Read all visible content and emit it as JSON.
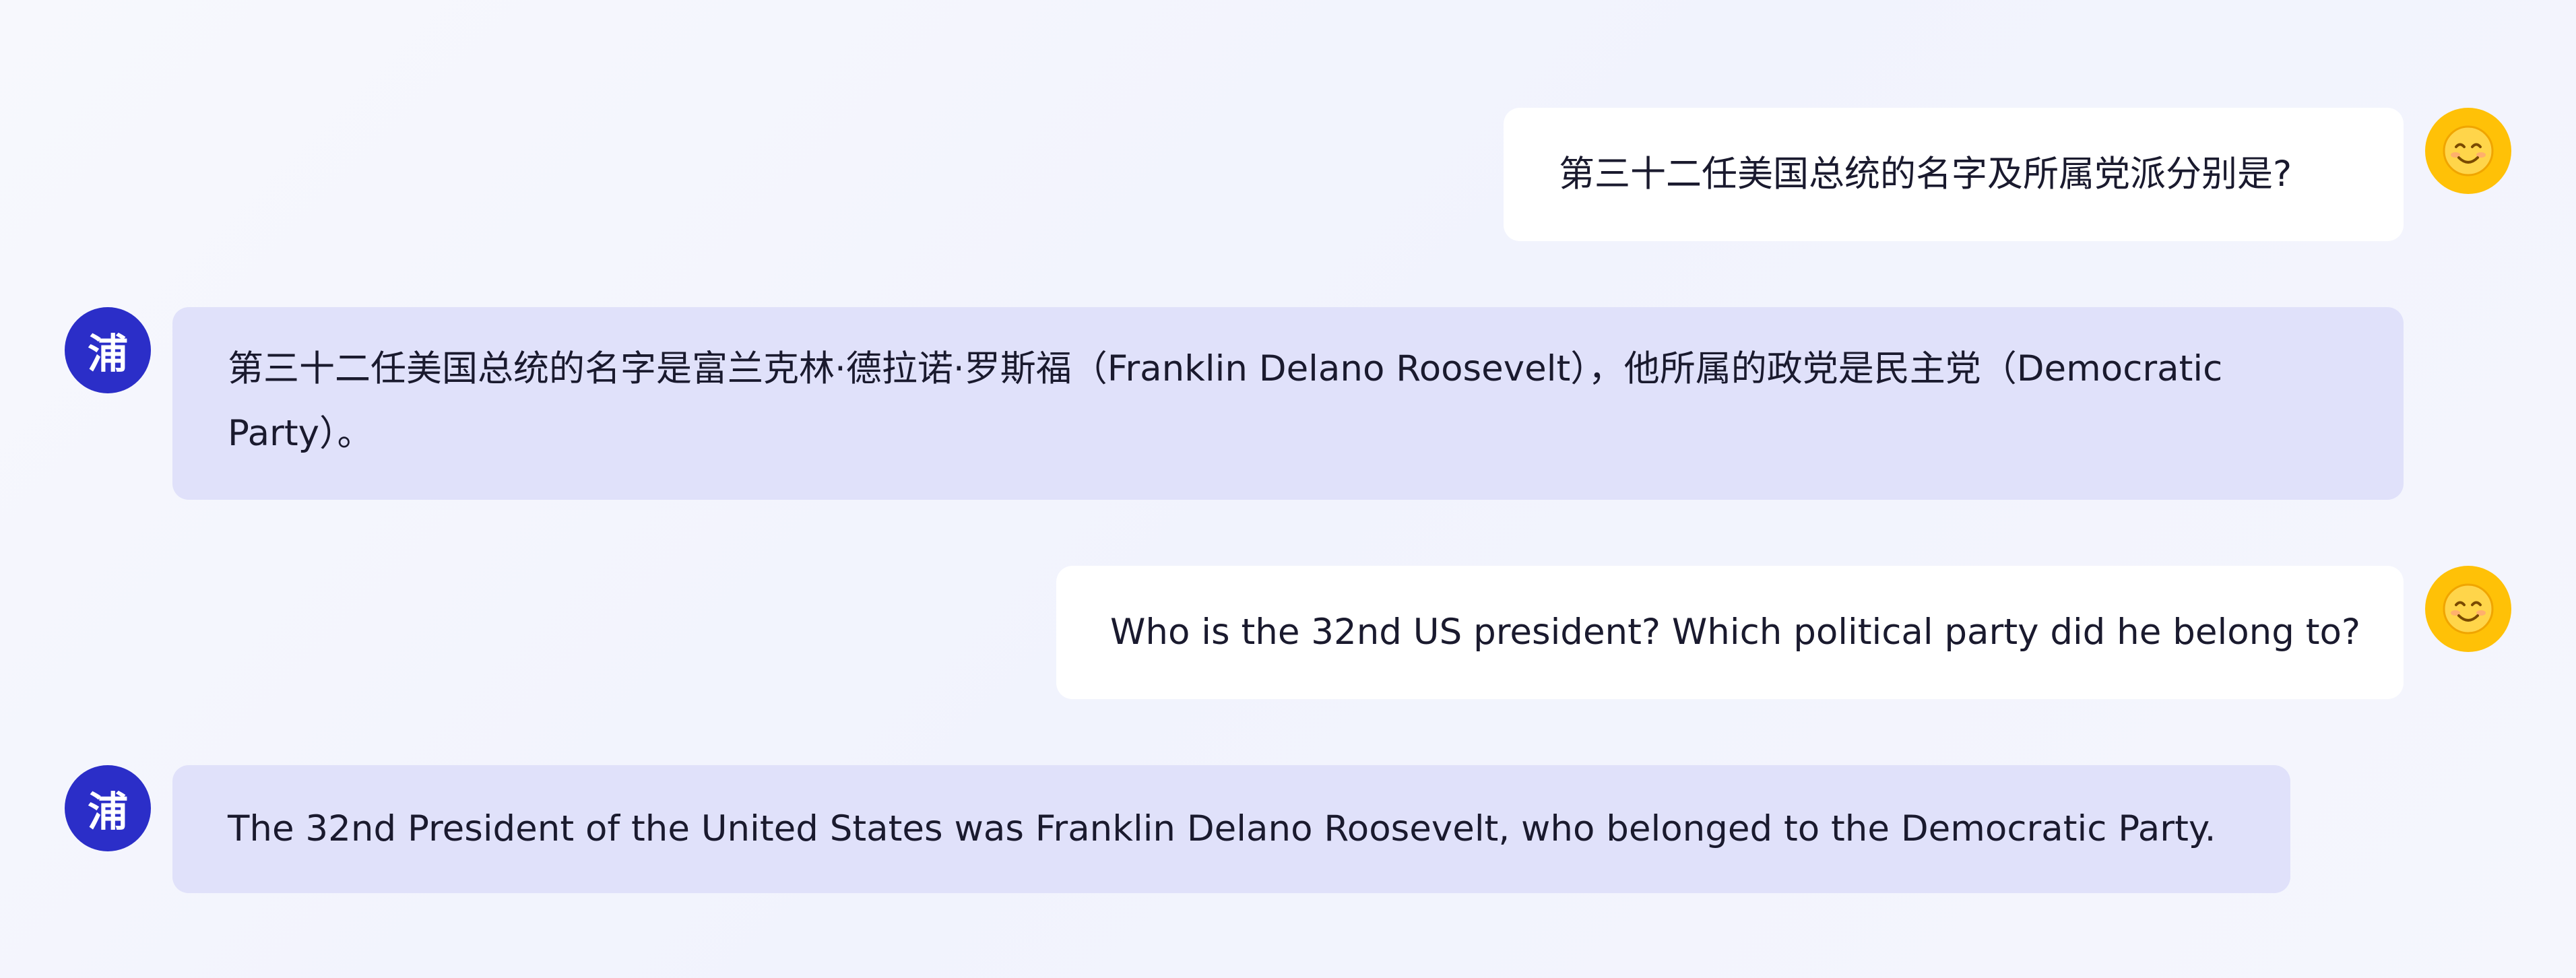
{
  "conversation": {
    "messages": [
      {
        "role": "user",
        "text": "第三十二任美国总统的名字及所属党派分别是?"
      },
      {
        "role": "assistant",
        "avatar_text": "浦",
        "text": "第三十二任美国总统的名字是富兰克林·德拉诺·罗斯福（Franklin Delano Roosevelt），他所属的政党是民主党（Democratic Party）。"
      },
      {
        "role": "user",
        "text": "Who is the 32nd US president? Which political party did he belong to?"
      },
      {
        "role": "assistant",
        "avatar_text": "浦",
        "text": "The 32nd President of the United States was Franklin Delano Roosevelt, who belonged to the Democratic Party."
      }
    ]
  },
  "icons": {
    "user_avatar": "smiling-face-icon",
    "bot_avatar": "pu-character-avatar"
  },
  "colors": {
    "user_bubble": "#ffffff",
    "bot_bubble": "#e0e1fa",
    "bot_avatar_bg": "#2b2ec8",
    "user_avatar_bg": "#ffc107"
  }
}
